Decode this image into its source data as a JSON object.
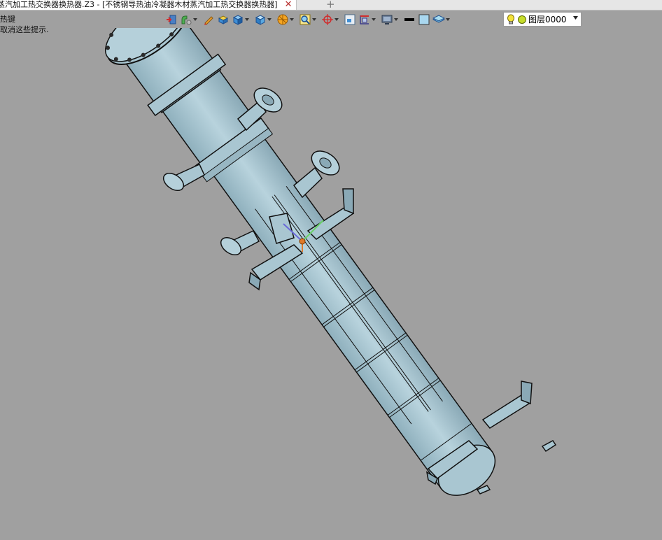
{
  "tab": {
    "title": "蒸汽加工热交换器换热器.Z3 - [不锈钢导热油冷凝器木材蒸汽加工热交换器换热器]",
    "close_glyph": "✕",
    "add_glyph": "+"
  },
  "hints": {
    "line1": "热键",
    "line2": "取消这些提示."
  },
  "toolbar": {
    "items": [
      {
        "icon": "exit-icon"
      },
      {
        "icon": "shape-select-icon"
      },
      {
        "icon": "pencil-icon"
      },
      {
        "icon": "solid-box-icon"
      },
      {
        "icon": "cube-icon"
      },
      {
        "icon": "view-cube-icon"
      },
      {
        "icon": "render-icon"
      },
      {
        "icon": "zoom-icon"
      },
      {
        "icon": "orbit-icon"
      },
      {
        "icon": "frame-icon"
      },
      {
        "icon": "section-icon"
      },
      {
        "icon": "display-icon"
      },
      {
        "icon": "line-color-icon"
      },
      {
        "icon": "face-color-icon"
      },
      {
        "icon": "layer-manager-icon"
      }
    ]
  },
  "layer": {
    "name": "图层0000",
    "bulb_color": "#f3e23a",
    "dot_color": "#c6dd2b"
  },
  "viewport": {
    "background": "#a0a0a0",
    "model_color": "#a9c6d1"
  }
}
